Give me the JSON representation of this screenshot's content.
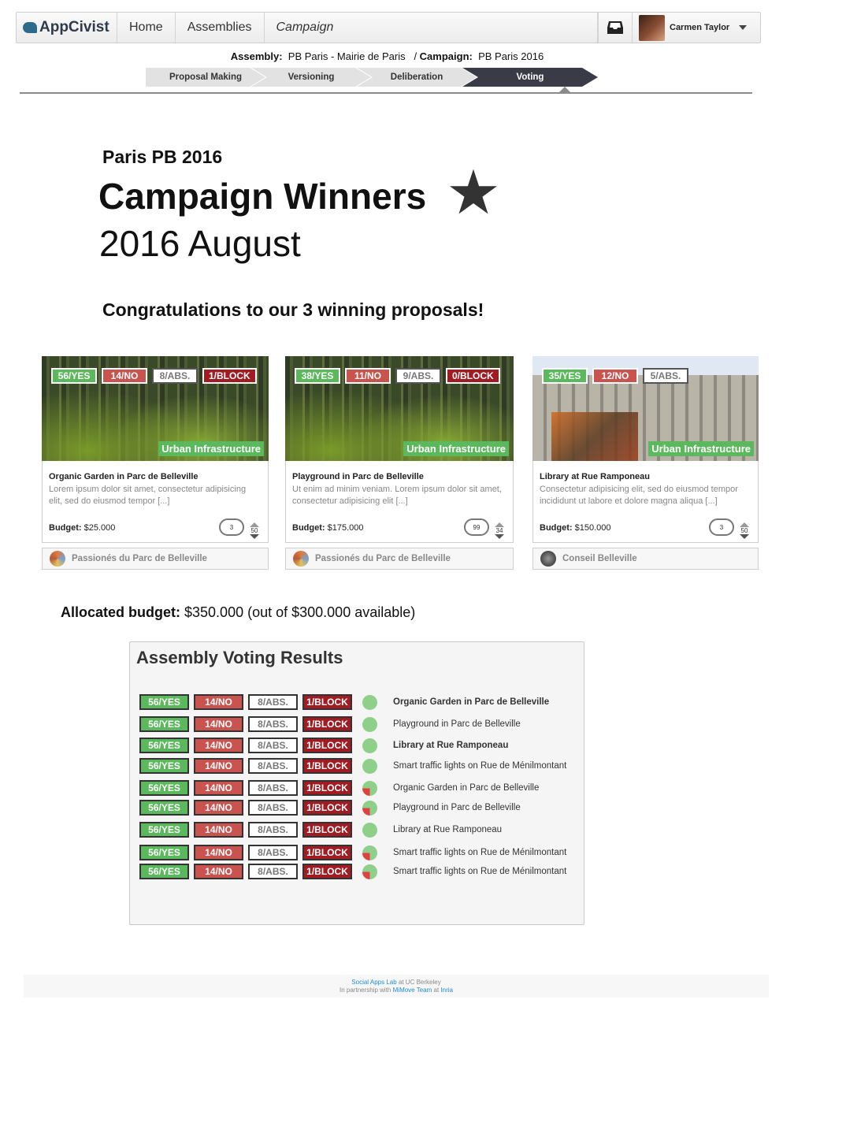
{
  "nav": {
    "brand": "AppCivist",
    "home": "Home",
    "assemblies": "Assemblies",
    "campaign": "Campaign",
    "user_name": "Carmen Taylor"
  },
  "context": {
    "assembly_label": "Assembly:",
    "assembly_value": "PB Paris - Mairie de Paris",
    "campaign_label": "Campaign:",
    "campaign_value": "PB Paris 2016"
  },
  "steps": [
    "Proposal Making",
    "Versioning",
    "Deliberation",
    "Voting"
  ],
  "active_step": "Voting",
  "hero": {
    "subtitle": "Paris PB 2016",
    "title": "Campaign Winners",
    "star": "★",
    "date": "2016 August",
    "congrats": "Congratulations to our 3 winning proposals!"
  },
  "cards": [
    {
      "votes": [
        "56/YES",
        "14/NO",
        "8/ABS.",
        "1/BLOCK"
      ],
      "category": "Urban Infrastructure",
      "title": "Organic Garden in Parc de Belleville",
      "description": "Lorem ipsum dolor sit amet, consectetur adipisicing elit, sed do eiusmod tempor [...]",
      "budget_label": "Budget:",
      "budget_value": "$25.000",
      "comments": "3",
      "score": "50",
      "group": "Passionés du Parc de Belleville"
    },
    {
      "votes": [
        "38/YES",
        "11/NO",
        "9/ABS.",
        "0/BLOCK"
      ],
      "category": "Urban Infrastructure",
      "title": "Playground in Parc de Belleville",
      "description": "Ut enim ad minim veniam. Lorem ipsum dolor sit amet, consectetur adipisicing elit [...]",
      "budget_label": "Budget:",
      "budget_value": "$175.000",
      "comments": "99",
      "score": "34",
      "group": "Passionés du Parc de Belleville"
    },
    {
      "votes": [
        "35/YES",
        "12/NO",
        "5/ABS."
      ],
      "category": "Urban Infrastructure",
      "title": "Library at Rue Ramponeau",
      "description": "Consectetur adipisicing elit, sed do eiusmod tempor incididunt ut labore et dolore magna aliqua [...]",
      "budget_label": "Budget:",
      "budget_value": "$150.000",
      "comments": "3",
      "score": "50",
      "group": "Conseil Belleville"
    }
  ],
  "allocated": {
    "label": "Allocated budget:",
    "value": "$350.000 (out of $300.000 available)"
  },
  "results": {
    "title": "Assembly Voting Results",
    "rows": [
      {
        "votes": [
          "56/YES",
          "14/NO",
          "8/ABS.",
          "1/BLOCK"
        ],
        "pie": "green",
        "label": "Organic Garden in Parc de Belleville",
        "bold": true
      },
      {
        "votes": [
          "56/YES",
          "14/NO",
          "8/ABS.",
          "1/BLOCK"
        ],
        "pie": "green",
        "label": "Playground in Parc de Belleville",
        "bold": false
      },
      {
        "votes": [
          "56/YES",
          "14/NO",
          "8/ABS.",
          "1/BLOCK"
        ],
        "pie": "green",
        "label": "Library at Rue Ramponeau",
        "bold": true
      },
      {
        "votes": [
          "56/YES",
          "14/NO",
          "8/ABS.",
          "1/BLOCK"
        ],
        "pie": "green",
        "label": "Smart traffic lights on Rue de Ménilmontant",
        "bold": false
      },
      {
        "votes": [
          "56/YES",
          "14/NO",
          "8/ABS.",
          "1/BLOCK"
        ],
        "pie": "mixed",
        "label": "Organic Garden in Parc de Belleville",
        "bold": false
      },
      {
        "votes": [
          "56/YES",
          "14/NO",
          "8/ABS.",
          "1/BLOCK"
        ],
        "pie": "mixed",
        "label": "Playground in Parc de Belleville",
        "bold": false
      },
      {
        "votes": [
          "56/YES",
          "14/NO",
          "8/ABS.",
          "1/BLOCK"
        ],
        "pie": "green",
        "label": "Library at Rue Ramponeau",
        "bold": false
      },
      {
        "votes": [
          "56/YES",
          "14/NO",
          "8/ABS.",
          "1/BLOCK"
        ],
        "pie": "mixed",
        "label": "Smart traffic lights on Rue de Ménilmontant",
        "bold": false
      },
      {
        "votes": [
          "56/YES",
          "14/NO",
          "8/ABS.",
          "1/BLOCK"
        ],
        "pie": "mixed",
        "label": "Smart traffic lights on Rue de Ménilmontant",
        "bold": false
      }
    ]
  },
  "footer": {
    "lab": "Social Apps Lab",
    "at1": "at UC Berkeley",
    "partner": "In partnership with",
    "team": "MiMove Team",
    "at2": "at",
    "inria": "Inria"
  },
  "colors": {
    "yes": "#5cb85c",
    "no": "#c9534f",
    "block": "#a11b22",
    "active_step": "#3b3b47",
    "link": "#1e8ed6"
  }
}
